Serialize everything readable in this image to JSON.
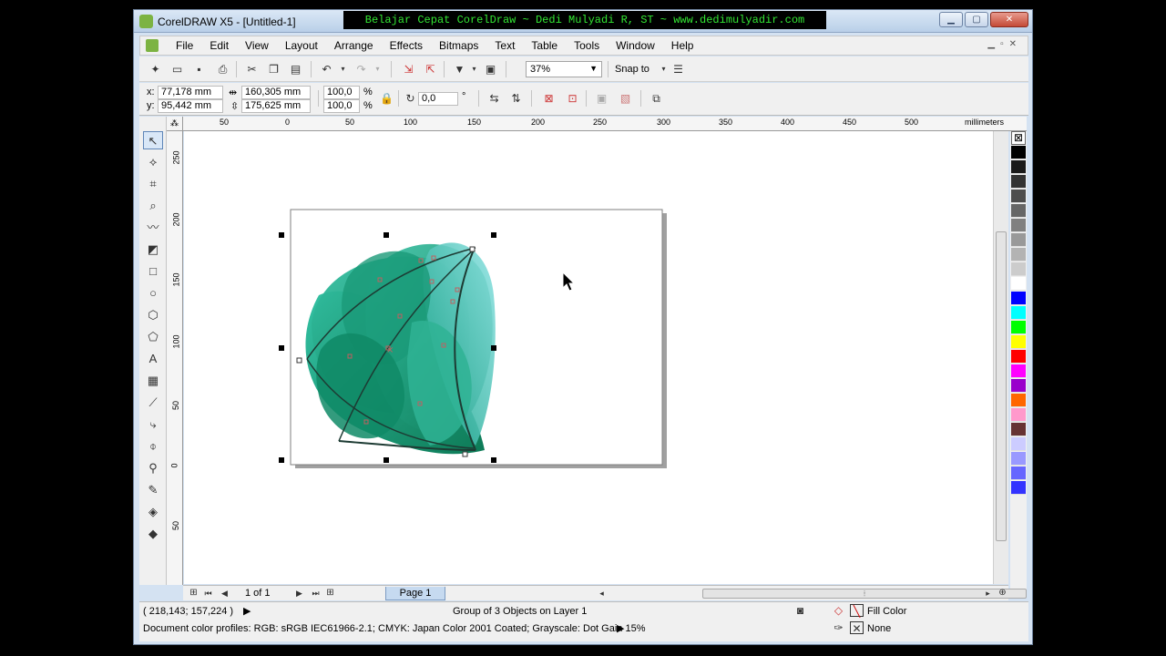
{
  "window": {
    "title": "CorelDRAW X5 - [Untitled-1]",
    "banner": "Belajar Cepat CorelDraw ~ Dedi Mulyadi R, ST ~ www.dedimulyadir.com"
  },
  "menu": [
    "File",
    "Edit",
    "View",
    "Layout",
    "Arrange",
    "Effects",
    "Bitmaps",
    "Text",
    "Table",
    "Tools",
    "Window",
    "Help"
  ],
  "standard_toolbar": {
    "zoom": "37%",
    "snap_to": "Snap to"
  },
  "property_bar": {
    "x_label": "x:",
    "y_label": "y:",
    "x": "77,178 mm",
    "y": "95,442 mm",
    "width": "160,305 mm",
    "height": "175,625 mm",
    "scale_x": "100,0",
    "scale_y": "100,0",
    "percent": "%",
    "rotation": "0,0",
    "degree": "°"
  },
  "rulers": {
    "unit": "millimeters",
    "top_ticks": [
      "50",
      "0",
      "50",
      "100",
      "150",
      "200",
      "250",
      "300",
      "350",
      "400",
      "450",
      "500"
    ],
    "left_ticks": [
      "250",
      "200",
      "150",
      "100",
      "50",
      "0",
      "50"
    ]
  },
  "page_nav": {
    "counter": "1 of 1",
    "page_tab": "Page 1"
  },
  "status": {
    "coords": "( 218,143; 157,224 )",
    "selection": "Group of 3 Objects on Layer 1",
    "fill_label": "Fill Color",
    "outline_label": "None",
    "profiles": "Document color profiles: RGB: sRGB IEC61966-2.1; CMYK: Japan Color 2001 Coated; Grayscale: Dot Gain 15%"
  },
  "palette": [
    "#000000",
    "#1a1a1a",
    "#333333",
    "#4d4d4d",
    "#666666",
    "#808080",
    "#999999",
    "#b3b3b3",
    "#cccccc",
    "#ffffff",
    "#0000ff",
    "#00ffff",
    "#00ff00",
    "#ffff00",
    "#ff0000",
    "#ff00ff",
    "#9900cc",
    "#ff6600",
    "#ff99cc",
    "#663333",
    "#ccccff",
    "#9999ff",
    "#6666ff",
    "#3333ff"
  ]
}
